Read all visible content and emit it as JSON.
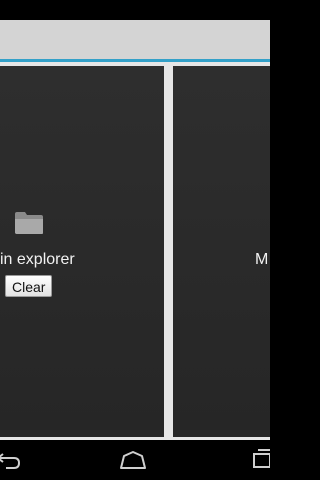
{
  "left_panel": {
    "text": "in explorer",
    "clear_label": "Clear",
    "icon": "folder-icon"
  },
  "right_panel": {
    "text": "M"
  },
  "nav_bar": {
    "icons": [
      "back-icon",
      "home-icon",
      "recents-icon"
    ]
  },
  "colors": {
    "action_bar": "#d4d4d4",
    "accent": "#33a0c8",
    "panel_bg": "#2a2a2a",
    "divider": "#e6e6e6"
  }
}
